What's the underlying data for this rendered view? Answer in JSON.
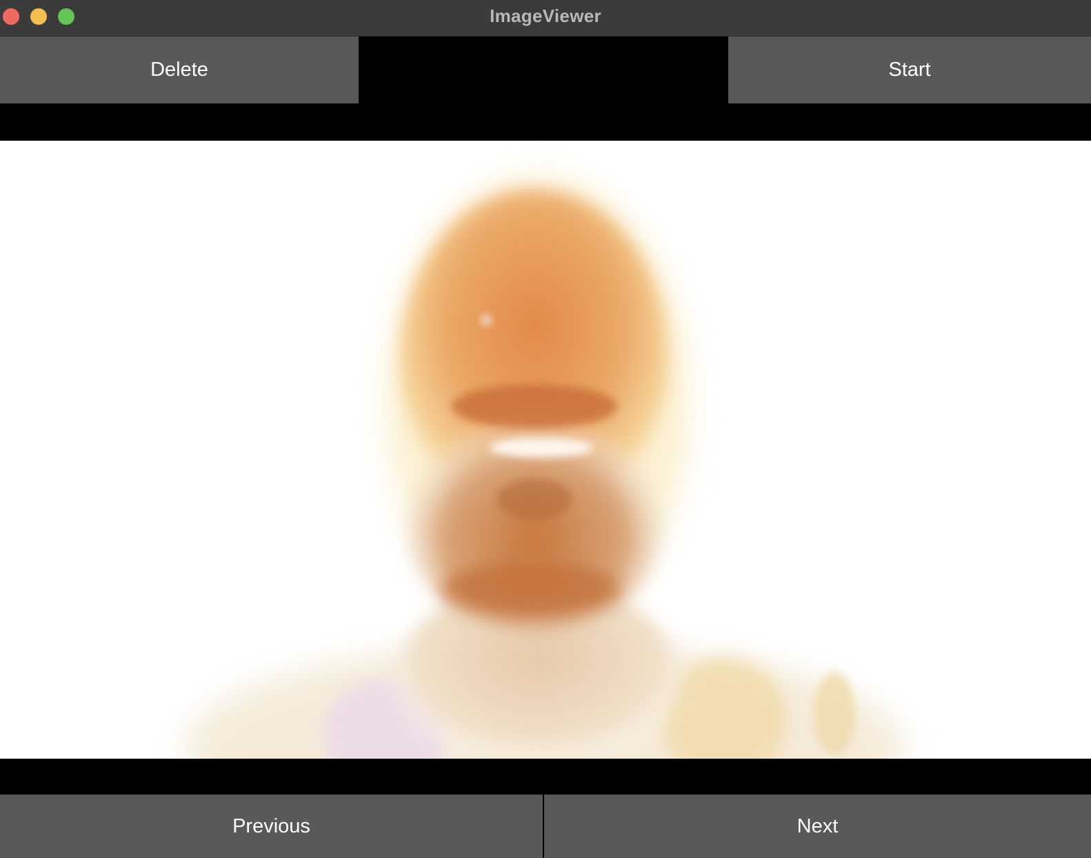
{
  "window": {
    "title": "ImageViewer"
  },
  "toolbar": {
    "delete_label": "Delete",
    "start_label": "Start"
  },
  "navigation": {
    "previous_label": "Previous",
    "next_label": "Next"
  },
  "viewer": {
    "image_description_icon": "overexposed-portrait-photo"
  }
}
